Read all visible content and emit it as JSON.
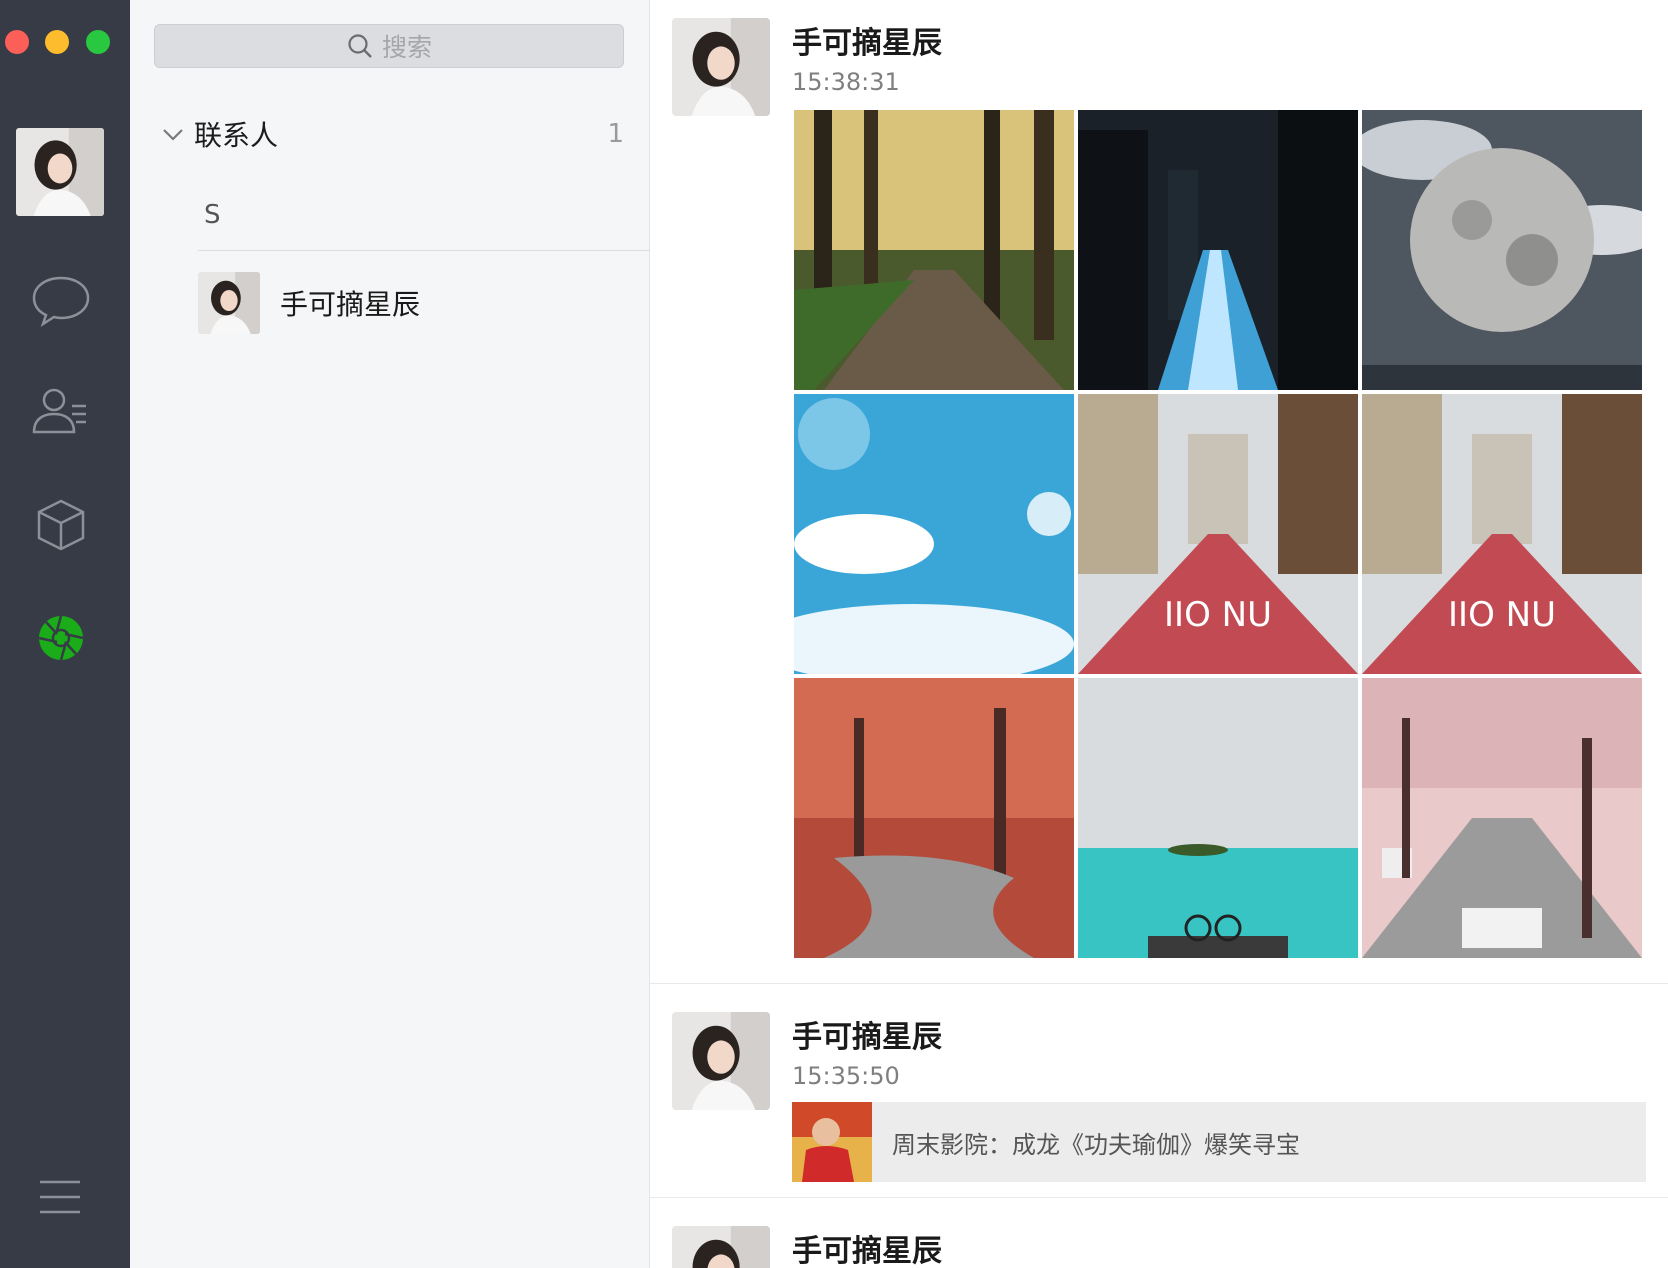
{
  "window": {
    "controls": [
      "close",
      "minimize",
      "maximize"
    ]
  },
  "sidebar": {
    "icons": [
      "chat-bubble-icon",
      "contacts-icon",
      "box-icon",
      "moments-icon",
      "menu-icon"
    ],
    "active_color": "#1aad19"
  },
  "search": {
    "placeholder": "搜索"
  },
  "contacts": {
    "group_title": "联系人",
    "group_count": "1",
    "letter": "S",
    "items": [
      {
        "name": "手可摘星辰"
      }
    ]
  },
  "feed": {
    "posts": [
      {
        "name": "手可摘星辰",
        "time": "15:38:31",
        "photos": 9
      },
      {
        "name": "手可摘星辰",
        "time": "15:35:50",
        "link_title": "周末影院：成龙《功夫瑜伽》爆笑寻宝"
      },
      {
        "name": "手可摘星辰"
      }
    ]
  }
}
